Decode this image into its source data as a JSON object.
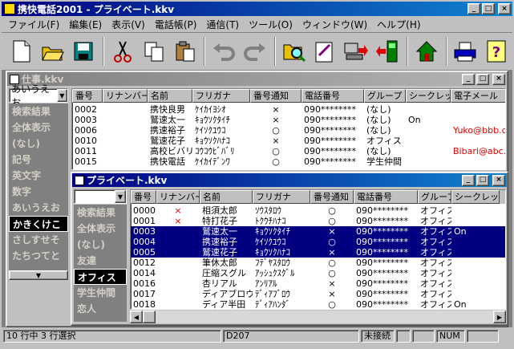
{
  "app": {
    "title": "携快電話2001 - プライベート.kkv"
  },
  "menus": [
    "ファイル(F)",
    "編集(E)",
    "表示(V)",
    "電話帳(P)",
    "通信(T)",
    "ツール(O)",
    "ウィンドウ(W)",
    "ヘルプ(H)"
  ],
  "toolbar": {
    "icons": [
      "new-icon",
      "open-icon",
      "save-icon",
      "cut-icon",
      "copy-icon",
      "paste-icon",
      "undo-icon",
      "redo-icon",
      "search-icon",
      "edit-icon",
      "send-to-phone-icon",
      "receive-from-phone-icon",
      "home-icon",
      "print-icon",
      "help-icon"
    ]
  },
  "work": {
    "title": "仕事.kkv",
    "combo": "あいうえお",
    "categories": [
      "検索結果",
      "全体表示",
      "(なし)",
      "記号",
      "英文字",
      "数字",
      "あいうえお",
      "かきくけこ",
      "さしすせそ",
      "たちつてと"
    ],
    "selected_category": 7,
    "columns": [
      "番号",
      "リナンバー",
      "名前",
      "フリガナ",
      "番号通知",
      "電話番号",
      "グループ",
      "シークレット",
      "電子メール"
    ],
    "rows": [
      {
        "no": "0002",
        "ren": "",
        "name": "携快良男",
        "kana": "ｹｲｶｲﾖｼｵ",
        "notify": "×",
        "phone": "090********",
        "group": "(なし)",
        "secret": "",
        "email": ""
      },
      {
        "no": "0003",
        "ren": "",
        "name": "鷲速太一",
        "kana": "ｷｮｳｿｸﾀｲﾁ",
        "notify": "×",
        "phone": "090********",
        "group": "(なし)",
        "secret": "On",
        "email": ""
      },
      {
        "no": "0006",
        "ren": "",
        "name": "携速裕子",
        "kana": "ｹｲｿｸﾕｳｺ",
        "notify": "○",
        "phone": "090********",
        "group": "(なし)",
        "secret": "",
        "email": "Yuko@bbb.co"
      },
      {
        "no": "0010",
        "ren": "",
        "name": "鷲速花子",
        "kana": "ｷｮｳｿｸﾊﾅｺ",
        "notify": "×",
        "phone": "090********",
        "group": "オフィス",
        "secret": "",
        "email": ""
      },
      {
        "no": "0011",
        "ren": "",
        "name": "高校ビバリ",
        "kana": "ｺｳｺｳﾋﾞﾊﾞﾘ",
        "notify": "○",
        "phone": "090********",
        "group": "(なし)",
        "secret": "",
        "email": "Bibari@abc.c"
      },
      {
        "no": "0015",
        "ren": "",
        "name": "携快電話",
        "kana": "ｹｲｶｲﾃﾞﾝﾜ",
        "notify": "○",
        "phone": "090********",
        "group": "学生仲間",
        "secret": "",
        "email": ""
      }
    ]
  },
  "private": {
    "title": "プライベート.kkv",
    "combo": "",
    "categories": [
      "検索結果",
      "全体表示",
      "(なし)",
      "友達",
      "オフィス",
      "学生仲間",
      "恋人"
    ],
    "selected_category": 4,
    "columns": [
      "番号",
      "リナンバー",
      "名前",
      "フリガナ",
      "番号通知",
      "電話番号",
      "グループ",
      "シークレット"
    ],
    "rows": [
      {
        "no": "0000",
        "ren": "×",
        "name": "相須太郎",
        "kana": "ｿｳｽﾀﾛｳ",
        "notify": "○",
        "phone": "090********",
        "group": "オフィス",
        "secret": "",
        "sel": false
      },
      {
        "no": "0001",
        "ren": "×",
        "name": "特打花子",
        "kana": "ﾄｸｳﾁﾊﾅｺ",
        "notify": "○",
        "phone": "090********",
        "group": "オフィス",
        "secret": "",
        "sel": false
      },
      {
        "no": "0003",
        "ren": "",
        "name": "鷲速太一",
        "kana": "ｷｮｳｿｸﾀｲﾁ",
        "notify": "×",
        "phone": "090********",
        "group": "オフィス",
        "secret": "On",
        "sel": true
      },
      {
        "no": "0004",
        "ren": "",
        "name": "携速裕子",
        "kana": "ｹｲｿｸﾕｳｺ",
        "notify": "○",
        "phone": "090********",
        "group": "オフィス",
        "secret": "",
        "sel": true
      },
      {
        "no": "0005",
        "ren": "",
        "name": "鷲速花子",
        "kana": "ｷｮｳｿｸﾊﾅｺ",
        "notify": "×",
        "phone": "090********",
        "group": "オフィス",
        "secret": "",
        "sel": true
      },
      {
        "no": "0012",
        "ren": "",
        "name": "筆休太郎",
        "kana": "ﾌﾃﾞﾔｽﾀﾛｳ",
        "notify": "○",
        "phone": "090********",
        "group": "オフィス",
        "secret": "",
        "sel": false
      },
      {
        "no": "0014",
        "ren": "",
        "name": "圧縮スグル",
        "kana": "ｱｯｼｭｸｽｸﾞﾙ",
        "notify": "○",
        "phone": "090********",
        "group": "オフィス",
        "secret": "",
        "sel": false
      },
      {
        "no": "0016",
        "ren": "",
        "name": "杏リアル",
        "kana": "ｱﾝﾘｱﾙ",
        "notify": "×",
        "phone": "090********",
        "group": "オフィス",
        "secret": "",
        "sel": false
      },
      {
        "no": "0017",
        "ren": "",
        "name": "ディアブロウ",
        "kana": "ﾃﾞｨｱﾌﾞﾛｳ",
        "notify": "×",
        "phone": "090********",
        "group": "オフィス",
        "secret": "",
        "sel": false
      },
      {
        "no": "0018",
        "ren": "",
        "name": "ディア半田",
        "kana": "ﾃﾞｨｱﾊﾝﾀﾞ",
        "notify": "○",
        "phone": "090********",
        "group": "オフィス",
        "secret": "On",
        "sel": false
      }
    ]
  },
  "status": {
    "count": "10 行中 3 行選択",
    "code": "D207",
    "conn": "未接続",
    "num": "NUM"
  }
}
